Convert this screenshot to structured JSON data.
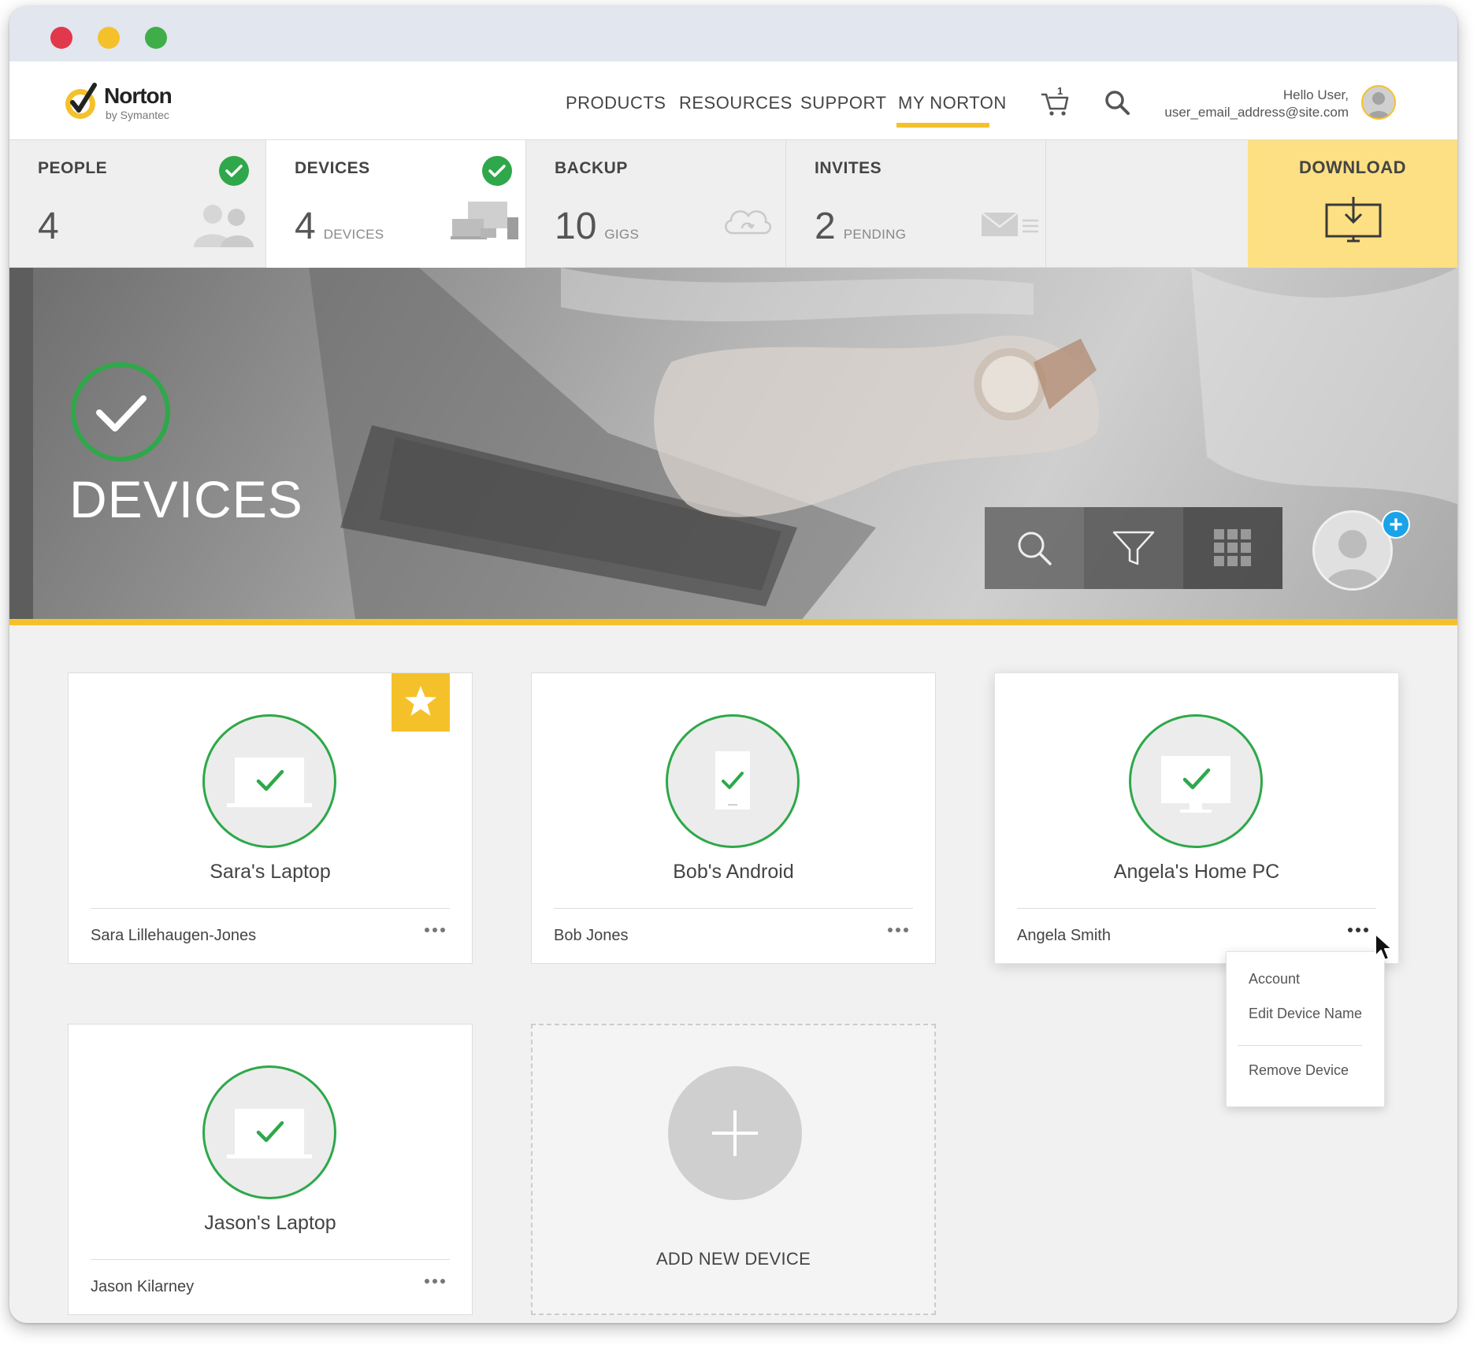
{
  "brand": {
    "name": "Norton",
    "sub": "by Symantec",
    "accent": "#f5c12b",
    "check_green": "#2ea84a",
    "badge_blue": "#1aa3e8"
  },
  "nav": {
    "links": [
      "PRODUCTS",
      "RESOURCES",
      "SUPPORT",
      "MY NORTON"
    ],
    "active": "MY NORTON",
    "cart_count": "1",
    "greeting": "Hello User,",
    "email": "user_email_address@site.com"
  },
  "stats": {
    "people": {
      "label": "PEOPLE",
      "value": "4",
      "unit": "",
      "status": "ok"
    },
    "devices": {
      "label": "DEVICES",
      "value": "4",
      "unit": "DEVICES",
      "status": "ok"
    },
    "backup": {
      "label": "BACKUP",
      "value": "10",
      "unit": "GIGS"
    },
    "invites": {
      "label": "INVITES",
      "value": "2",
      "unit": "PENDING"
    },
    "download": {
      "label": "DOWNLOAD"
    }
  },
  "hero": {
    "title": "DEVICES",
    "tools": [
      "search-icon",
      "filter-icon",
      "grid-icon"
    ],
    "add_badge": "+"
  },
  "devices": [
    {
      "name": "Sara's Laptop",
      "owner": "Sara Lillehaugen-Jones",
      "type": "laptop",
      "favorite": true
    },
    {
      "name": "Bob's Android",
      "owner": "Bob Jones",
      "type": "phone",
      "favorite": false
    },
    {
      "name": "Angela's Home PC",
      "owner": "Angela Smith",
      "type": "desktop",
      "favorite": false
    },
    {
      "name": "Jason's Laptop",
      "owner": "Jason Kilarney",
      "type": "laptop",
      "favorite": false
    }
  ],
  "add_device": {
    "label": "ADD NEW DEVICE"
  },
  "context_menu": {
    "items": [
      "Account",
      "Edit Device Name",
      "Remove Device"
    ]
  }
}
